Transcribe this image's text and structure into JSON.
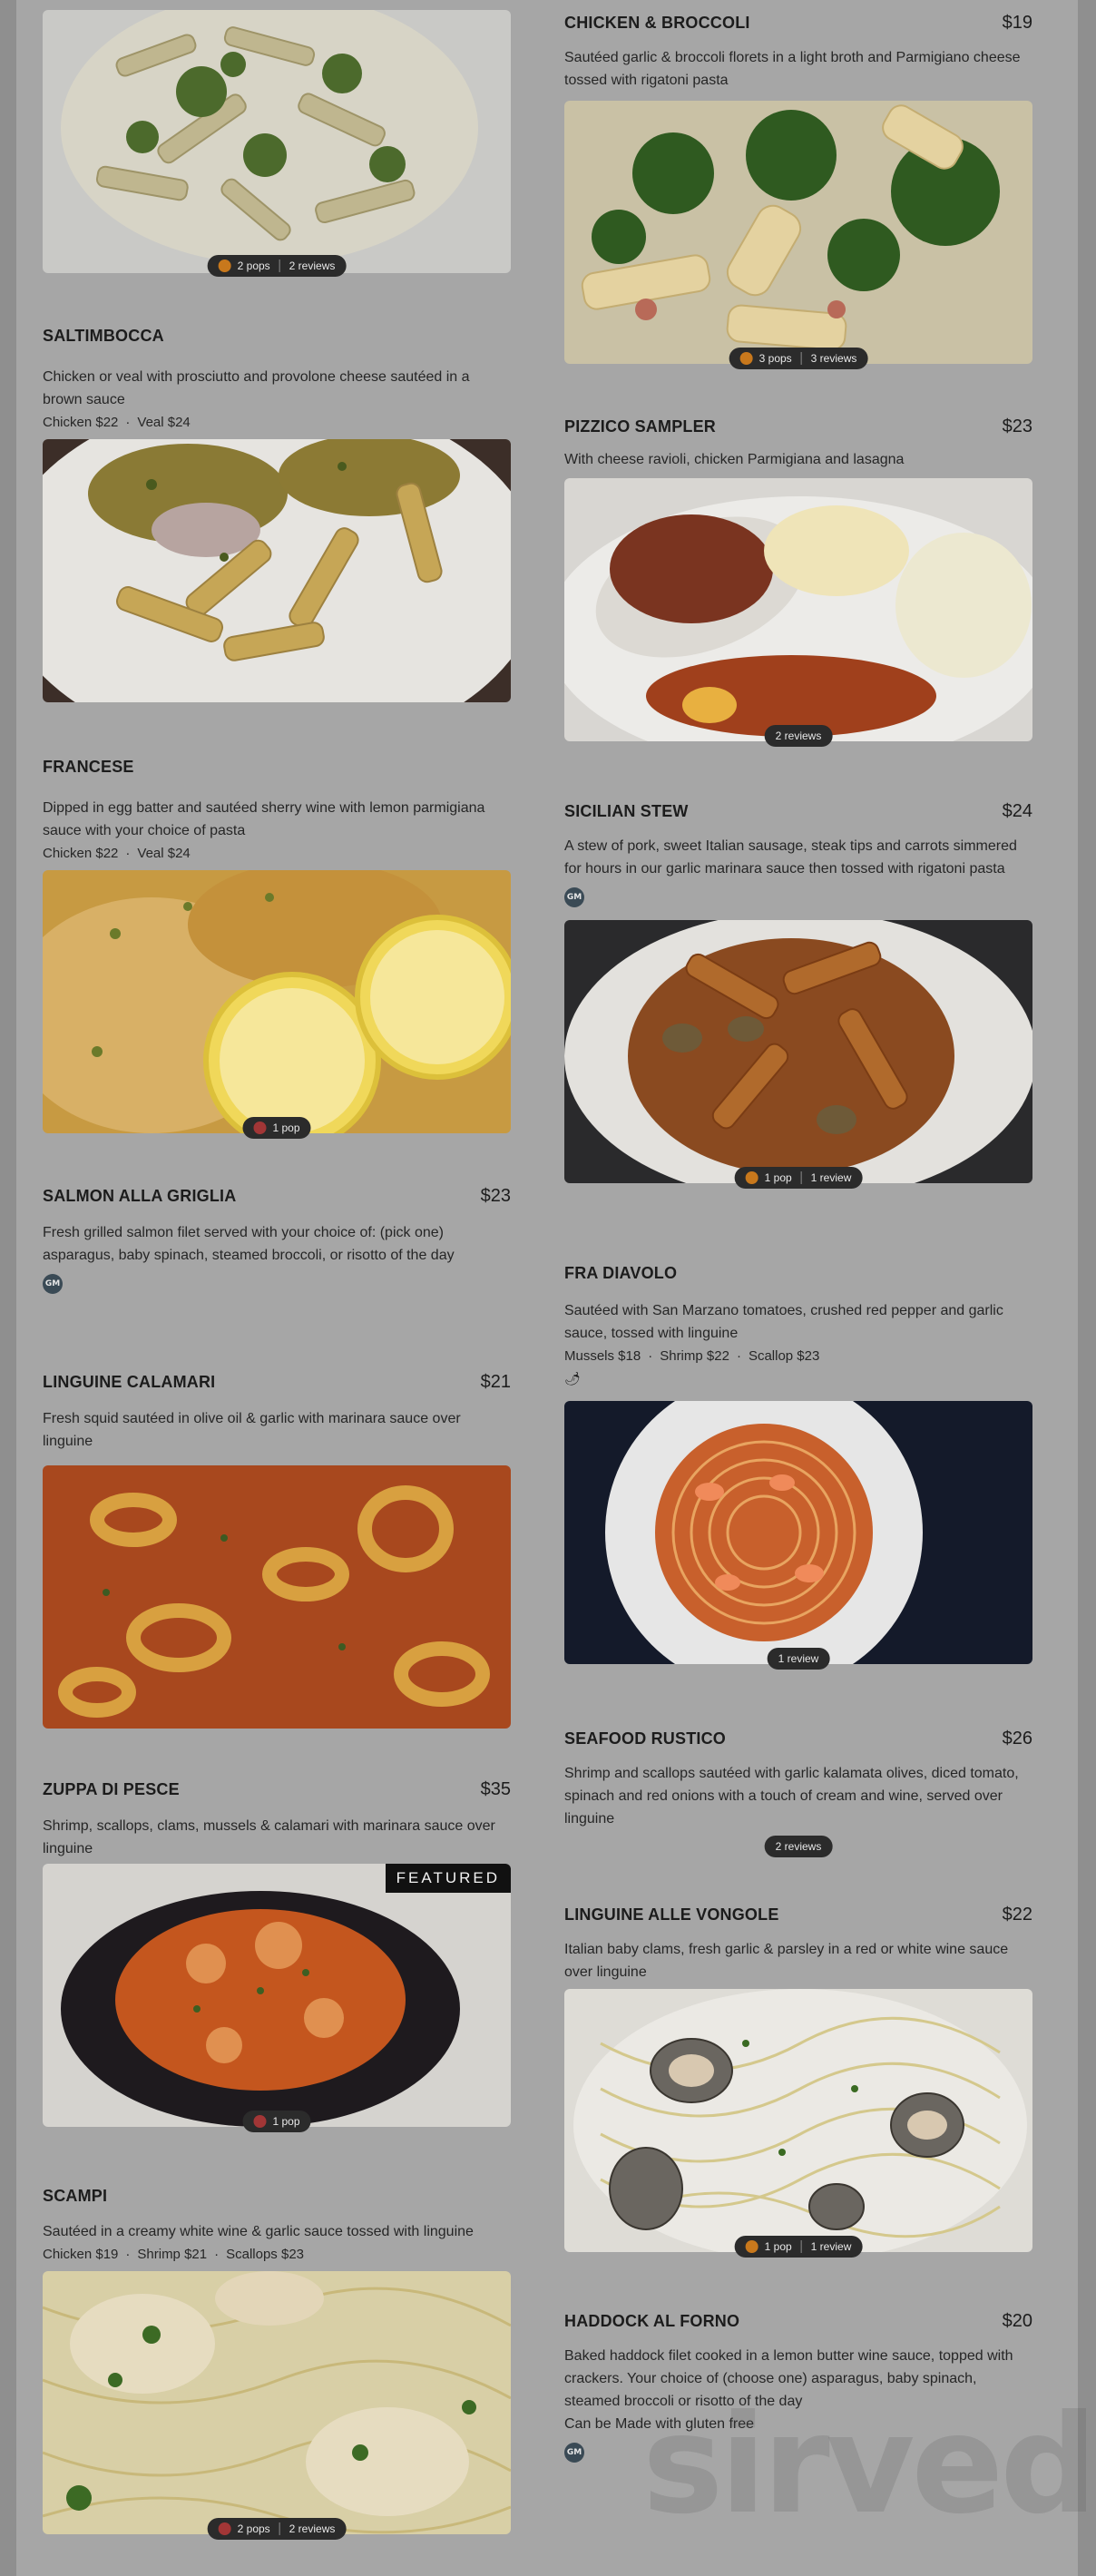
{
  "left_column": [
    {
      "top": 0,
      "photo_only": true,
      "reviews": {
        "pops": "2 pops",
        "reviews": "2 reviews",
        "pip": "orange"
      }
    },
    {
      "name": "SALTIMBOCCA",
      "desc": "Chicken or veal with prosciutto and provolone cheese sautéed in a brown sauce",
      "opts": [
        "Chicken $22",
        "Veal $24"
      ]
    },
    {
      "name": "FRANCESE",
      "desc": "Dipped in egg batter and sautéed sherry wine with lemon parmigiana sauce with your choice of pasta",
      "opts": [
        "Chicken $22",
        "Veal $24"
      ],
      "reviews": {
        "pops": "1 pop",
        "pip": "red"
      }
    },
    {
      "name": "SALMON ALLA GRIGLIA",
      "price": "$23",
      "desc": "Fresh grilled salmon filet served with your choice of: (pick one) asparagus, baby spinach, steamed broccoli, or risotto of the day",
      "avatar": "GM"
    },
    {
      "name": "LINGUINE CALAMARI",
      "price": "$21",
      "desc": "Fresh squid sautéed in olive oil & garlic with marinara sauce over linguine"
    },
    {
      "name": "ZUPPA DI PESCE",
      "price": "$35",
      "desc": "Shrimp, scallops, clams, mussels & calamari with marinara sauce over linguine",
      "featured": "FEATURED",
      "reviews": {
        "pops": "1 pop",
        "pip": "red"
      }
    },
    {
      "name": "SCAMPI",
      "desc": "Sautéed in a creamy white wine & garlic sauce tossed with linguine",
      "opts": [
        "Chicken $19",
        "Shrimp $21",
        "Scallops $23"
      ],
      "reviews": {
        "pops": "2 pops",
        "reviews": "2 reviews",
        "pip": "red"
      }
    }
  ],
  "right_column": [
    {
      "name": "CHICKEN & BROCCOLI",
      "price": "$19",
      "desc": "Sautéed garlic & broccoli florets in a light broth and Parmigiano cheese tossed with rigatoni pasta",
      "reviews": {
        "pops": "3 pops",
        "reviews": "3 reviews",
        "pip": "orange"
      }
    },
    {
      "name": "PIZZICO SAMPLER",
      "price": "$23",
      "desc": "With cheese ravioli, chicken Parmigiana and lasagna",
      "reviews": {
        "reviews": "2 reviews"
      }
    },
    {
      "name": "SICILIAN STEW",
      "price": "$24",
      "desc": "A stew of pork, sweet Italian sausage, steak tips and carrots simmered for hours in our garlic marinara sauce then tossed with rigatoni pasta",
      "avatar": "GM",
      "reviews": {
        "pops": "1 pop",
        "reviews": "1 review",
        "pip": "orange"
      }
    },
    {
      "name": "FRA DIAVOLO",
      "desc": "Sautéed with San Marzano tomatoes, crushed red pepper and garlic sauce, tossed with linguine",
      "opts": [
        "Mussels $18",
        "Shrimp $22",
        "Scallop $23"
      ],
      "chili": "🌶",
      "reviews": {
        "reviews": "1 review"
      }
    },
    {
      "name": "SEAFOOD RUSTICO",
      "price": "$26",
      "desc": "Shrimp and scallops sautéed with garlic kalamata olives, diced tomato, spinach and red onions with a touch of cream and wine, served over linguine",
      "reviews": {
        "reviews": "2 reviews"
      }
    },
    {
      "name": "LINGUINE ALLE VONGOLE",
      "price": "$22",
      "desc": "Italian baby clams, fresh garlic & parsley in a red or white wine sauce over linguine",
      "reviews": {
        "pops": "1 pop",
        "reviews": "1 review",
        "pip": "orange"
      }
    },
    {
      "name": "HADDOCK AL FORNO",
      "price": "$20",
      "desc": "Baked haddock filet cooked in a lemon butter wine sauce, topped with crackers. Your choice of (choose one) asparagus, baby spinach, steamed broccoli or risotto of the day",
      "extra": "Can be Made with gluten free",
      "avatar": "GM"
    }
  ],
  "watermark": "sirved"
}
